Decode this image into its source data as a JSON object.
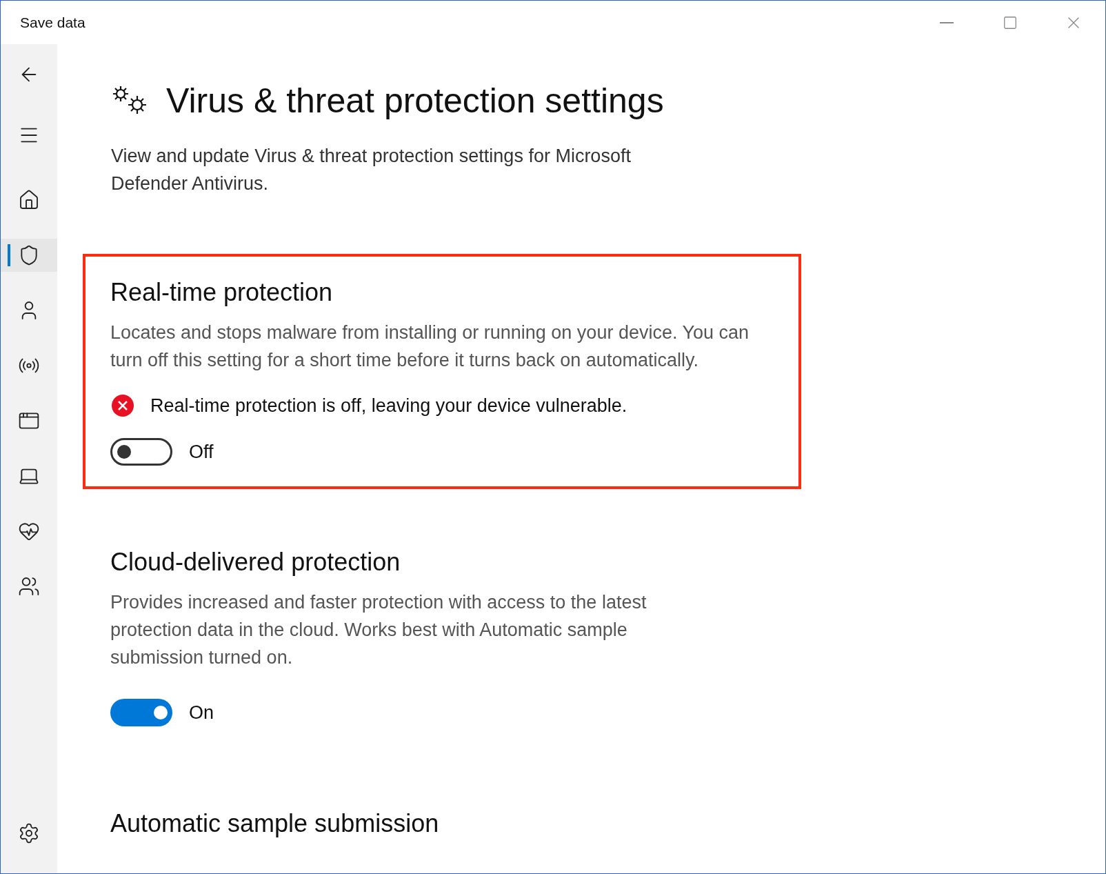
{
  "window": {
    "title": "Save data"
  },
  "sidebar": {
    "items": [
      {
        "kind": "back",
        "selected": false
      },
      {
        "kind": "menu",
        "selected": false
      },
      {
        "kind": "home",
        "selected": false
      },
      {
        "kind": "shield",
        "selected": true
      },
      {
        "kind": "person",
        "selected": false
      },
      {
        "kind": "wireless",
        "selected": false
      },
      {
        "kind": "browser",
        "selected": false
      },
      {
        "kind": "laptop",
        "selected": false
      },
      {
        "kind": "health",
        "selected": false
      },
      {
        "kind": "family",
        "selected": false
      },
      {
        "kind": "settings",
        "selected": false
      }
    ]
  },
  "page": {
    "title": "Virus & threat protection settings",
    "description": "View and update Virus & threat protection settings for Microsoft Defender Antivirus."
  },
  "sections": [
    {
      "title": "Real-time protection",
      "highlighted": true,
      "description": "Locates and stops malware from installing or running on your device. You can turn off this setting for a short time before it turns back on automatically.",
      "status": {
        "kind": "error",
        "text": "Real-time protection is off, leaving your device vulnerable."
      },
      "toggle": {
        "on": false,
        "label": "Off"
      }
    },
    {
      "title": "Cloud-delivered protection",
      "highlighted": false,
      "description": "Provides increased and faster protection with access to the latest protection data in the cloud. Works best with Automatic sample submission turned on.",
      "toggle": {
        "on": true,
        "label": "On"
      }
    },
    {
      "title": "Automatic sample submission",
      "highlighted": false
    }
  ]
}
